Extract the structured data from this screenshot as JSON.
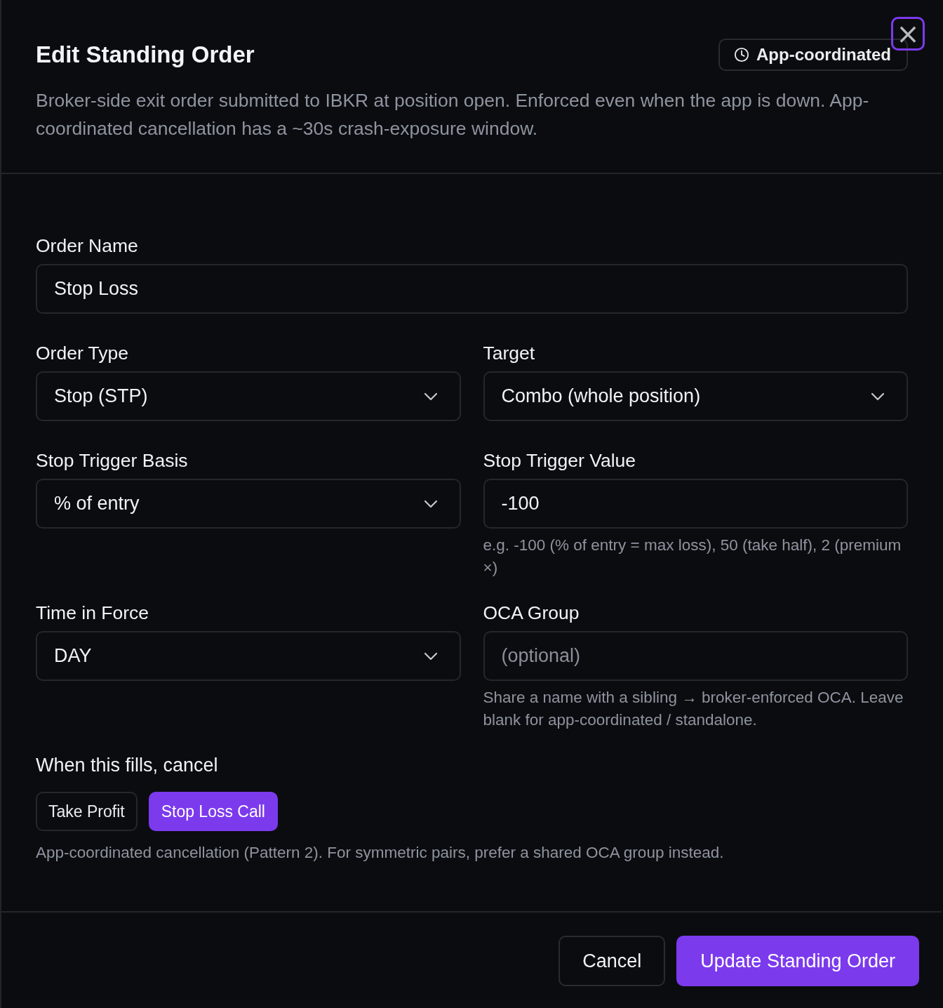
{
  "dialog": {
    "title": "Edit Standing Order",
    "badge": "App-coordinated",
    "close_label": "×",
    "description": "Broker-side exit order submitted to IBKR at position open. Enforced even when the app is down. App-coordinated cancellation has a ~30s crash-exposure window."
  },
  "rows": [
    [
      {
        "kind": "text",
        "label": "Order Name",
        "value": "Stop Loss"
      }
    ],
    [
      {
        "kind": "select",
        "label": "Order Type",
        "value": "Stop (STP)"
      },
      {
        "kind": "select",
        "label": "Target",
        "value": "Combo (whole position)"
      }
    ],
    [
      {
        "kind": "select",
        "label": "Stop Trigger Basis",
        "value": "% of entry"
      },
      {
        "kind": "text",
        "label": "Stop Trigger Value",
        "value": "-100",
        "hint": "e.g. -100 (% of entry = max loss), 50 (take half), 2 (premium ×)"
      }
    ],
    [
      {
        "kind": "select",
        "label": "Time in Force",
        "value": "DAY"
      },
      {
        "kind": "text",
        "label": "OCA Group",
        "placeholder": "(optional)",
        "hint": "Share a name with a sibling → broker-enforced OCA. Leave blank for app-coordinated / standalone."
      }
    ]
  ],
  "cancel_group": {
    "label": "When this fills, cancel",
    "chips": [
      {
        "label": "Take Profit",
        "selected": false
      },
      {
        "label": "Stop Loss Call",
        "selected": true
      }
    ],
    "note": "App-coordinated cancellation (Pattern 2). For symmetric pairs, prefer a shared OCA group instead."
  },
  "footer": {
    "buttons": [
      {
        "label": "Cancel",
        "kind": "secondary"
      },
      {
        "label": "Update Standing Order",
        "kind": "primary"
      }
    ]
  }
}
